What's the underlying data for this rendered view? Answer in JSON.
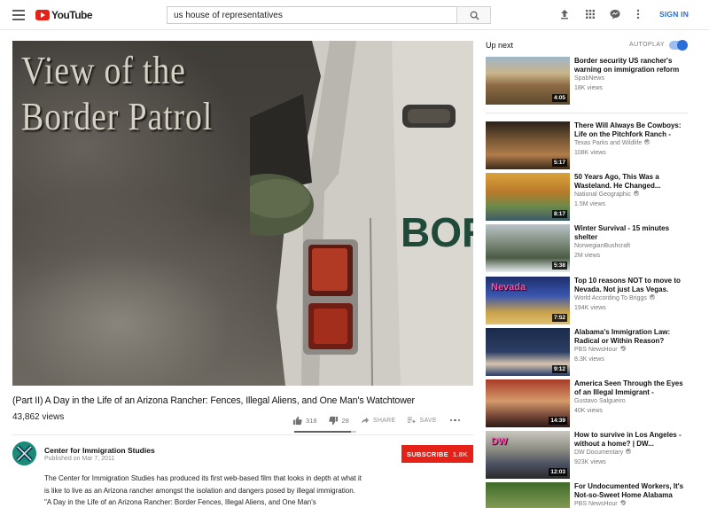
{
  "header": {
    "logo_text": "YouTube",
    "search_value": "us house of representatives",
    "signin_label": "SIGN IN"
  },
  "player": {
    "title_overlay": "View of the\nBorder Patrol",
    "truck_text": "BOR"
  },
  "video": {
    "title": "(Part II) A Day in the Life of an Arizona Rancher: Fences, Illegal Aliens, and One Man's Watchtower",
    "views": "43,862 views",
    "likes": "318",
    "dislikes": "28",
    "share_label": "SHARE",
    "save_label": "SAVE",
    "like_ratio": 0.92
  },
  "channel": {
    "name": "Center for Immigration Studies",
    "published": "Published on Mar 7, 2011",
    "subscribe_label": "SUBSCRIBE",
    "subscriber_count": "1.8K",
    "description": "The Center for Immigration Studies has produced its first web-based film that looks in depth at what it is like to live as an Arizona rancher amongst the isolation and dangers posed by illegal immigration. \"A Day in the Life of an Arizona Rancher: Border Fences, Illegal Aliens, and One Man's"
  },
  "sidebar": {
    "up_next_label": "Up next",
    "autoplay_label": "AUTOPLAY",
    "autoplay_on": true,
    "items": [
      {
        "title": "Border security US rancher's warning on immigration reform",
        "channel": "SpabNews",
        "verified": false,
        "views": "18K views",
        "duration": "4:05"
      },
      {
        "title": "There Will Always Be Cowboys: Life on the Pitchfork Ranch -",
        "channel": "Texas Parks and Wildlife",
        "verified": true,
        "views": "108K views",
        "duration": "5:17"
      },
      {
        "title": "50 Years Ago, This Was a Wasteland. He Changed...",
        "channel": "National Geographic",
        "verified": true,
        "views": "1.5M views",
        "duration": "8:17"
      },
      {
        "title": "Winter Survival - 15 minutes shelter",
        "channel": "NorwegianBushcraft",
        "verified": false,
        "views": "2M views",
        "duration": "5:38"
      },
      {
        "title": "Top 10 reasons NOT to move to Nevada. Not just Las Vegas.",
        "channel": "World According To Briggs",
        "verified": true,
        "views": "194K views",
        "duration": "7:52",
        "thumb_text": "Nevada"
      },
      {
        "title": "Alabama's Immigration Law: Radical or Within Reason?",
        "channel": "PBS NewsHour",
        "verified": true,
        "views": "8.3K views",
        "duration": "9:12"
      },
      {
        "title": "America Seen Through the Eyes of an Illegal Immigrant -",
        "channel": "Gustavo Salgueiro",
        "verified": false,
        "views": "40K views",
        "duration": "14:39"
      },
      {
        "title": "How to survive in Los Angeles - without a home? | DW...",
        "channel": "DW Documentary",
        "verified": true,
        "views": "923K views",
        "duration": "12:03",
        "thumb_text": "DW"
      },
      {
        "title": "For Undocumented Workers, It's Not-so-Sweet Home Alabama",
        "channel": "PBS NewsHour",
        "verified": true,
        "views": "",
        "duration": ""
      }
    ]
  }
}
